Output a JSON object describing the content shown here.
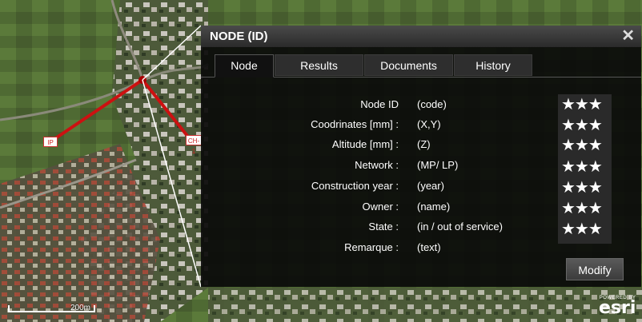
{
  "map": {
    "scale_label": "200m",
    "attribution_powered": "POWERED BY",
    "attribution_logo": "esri",
    "markers": [
      {
        "label": "IP"
      },
      {
        "label": "CH-1"
      }
    ]
  },
  "popup": {
    "title": "NODE (ID)",
    "close_label": "✕",
    "tabs": [
      {
        "label": "Node",
        "active": true
      },
      {
        "label": "Results",
        "active": false
      },
      {
        "label": "Documents",
        "active": false
      },
      {
        "label": "History",
        "active": false
      }
    ],
    "fields": [
      {
        "label": "Node ID",
        "value": "(code)",
        "rating": "★★★"
      },
      {
        "label": "Coodrinates [mm] :",
        "value": "(X,Y)",
        "rating": "★★★"
      },
      {
        "label": "Altitude [mm] :",
        "value": "(Z)",
        "rating": "★★★"
      },
      {
        "label": "Network :",
        "value": "(MP/ LP)",
        "rating": "★★★"
      },
      {
        "label": "Construction year :",
        "value": "(year)",
        "rating": "★★★"
      },
      {
        "label": "Owner :",
        "value": "(name)",
        "rating": "★★★"
      },
      {
        "label": "State :",
        "value": "(in / out of service)",
        "rating": "★★★"
      },
      {
        "label": "Remarque :",
        "value": "(text)"
      }
    ],
    "modify_label": "Modify"
  },
  "colors": {
    "network_line": "#cc1111",
    "popup_bg": "#0a0a0a"
  }
}
